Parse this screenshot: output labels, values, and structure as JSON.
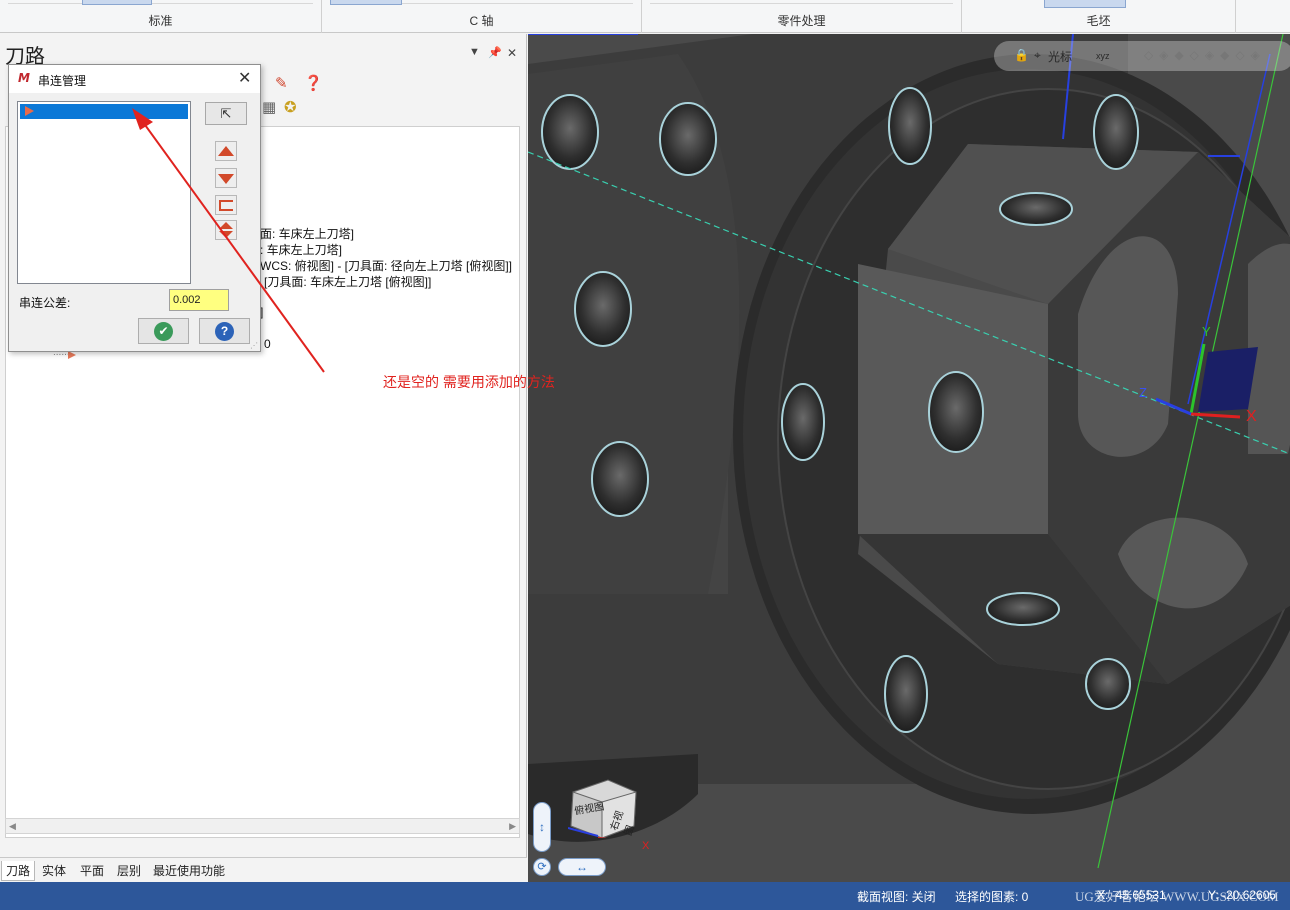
{
  "ribbon": {
    "groups": [
      {
        "label": "标准"
      },
      {
        "label": "C 轴"
      },
      {
        "label": "零件处理"
      },
      {
        "label": "毛坯"
      }
    ]
  },
  "panel": {
    "title": "刀路",
    "tree_lines": [
      "面: 车床左上刀塔]",
      ": 车床左上刀塔]",
      "WCS: 俯视图] - [刀具面: 径向左上刀塔 [俯视图]]",
      "[刀具面: 车床左上刀塔 [俯视图]]",
      "]",
      "0"
    ],
    "bottom_tabs": [
      "刀路",
      "实体",
      "平面",
      "层别",
      "最近使用功能"
    ]
  },
  "dialog": {
    "title": "串连管理",
    "close_glyph": "✕",
    "tolerance_label": "串连公差:",
    "tolerance_value": "0.002"
  },
  "annotation": {
    "text": "还是空的  需要用添加的方法",
    "color": "#e0231f"
  },
  "viewport": {
    "toolbar_label": "光标",
    "axis_labels": {
      "x": "X",
      "y": "Y",
      "z": "Z"
    },
    "view_cube": {
      "face_front": "俯视图",
      "face_right": "右视图"
    }
  },
  "status": {
    "section_view": "截面视图: 关闭",
    "selected": "选择的图素: 0",
    "x_coord": "X: -45.65531",
    "y_coord": "Y: -20.62605"
  },
  "watermark": "UG爱好者论坛 WWW.UGSNX.COM",
  "colors": {
    "status_bar": "#2d579a",
    "selection": "#0b78d7",
    "annotation": "#e0231f",
    "tolerance_field": "#ffff80"
  }
}
